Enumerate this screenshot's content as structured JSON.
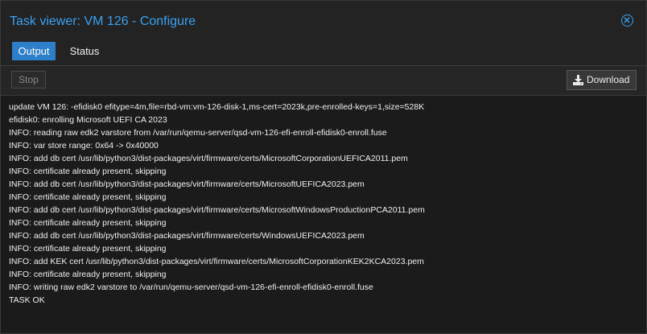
{
  "window": {
    "title": "Task viewer: VM 126 - Configure",
    "close_icon": "close-circle-icon"
  },
  "tabs": [
    {
      "label": "Output",
      "active": true
    },
    {
      "label": "Status",
      "active": false
    }
  ],
  "toolbar": {
    "stop_label": "Stop",
    "download_label": "Download",
    "download_icon": "download-icon"
  },
  "log": {
    "lines": [
      "update VM 126: -efidisk0 efitype=4m,file=rbd-vm:vm-126-disk-1,ms-cert=2023k,pre-enrolled-keys=1,size=528K",
      "efidisk0: enrolling Microsoft UEFI CA 2023",
      "INFO: reading raw edk2 varstore from /var/run/qemu-server/qsd-vm-126-efi-enroll-efidisk0-enroll.fuse",
      "INFO: var store range: 0x64 -> 0x40000",
      "INFO: add db cert /usr/lib/python3/dist-packages/virt/firmware/certs/MicrosoftCorporationUEFICA2011.pem",
      "INFO: certificate already present, skipping",
      "INFO: add db cert /usr/lib/python3/dist-packages/virt/firmware/certs/MicrosoftUEFICA2023.pem",
      "INFO: certificate already present, skipping",
      "INFO: add db cert /usr/lib/python3/dist-packages/virt/firmware/certs/MicrosoftWindowsProductionPCA2011.pem",
      "INFO: certificate already present, skipping",
      "INFO: add db cert /usr/lib/python3/dist-packages/virt/firmware/certs/WindowsUEFICA2023.pem",
      "INFO: certificate already present, skipping",
      "INFO: add KEK cert /usr/lib/python3/dist-packages/virt/firmware/certs/MicrosoftCorporationKEK2KCA2023.pem",
      "INFO: certificate already present, skipping",
      "INFO: writing raw edk2 varstore to /var/run/qemu-server/qsd-vm-126-efi-enroll-efidisk0-enroll.fuse",
      "TASK OK"
    ]
  },
  "colors": {
    "accent": "#3ba1f0",
    "active_tab": "#2d7fc9",
    "background": "#1b1b1b"
  }
}
